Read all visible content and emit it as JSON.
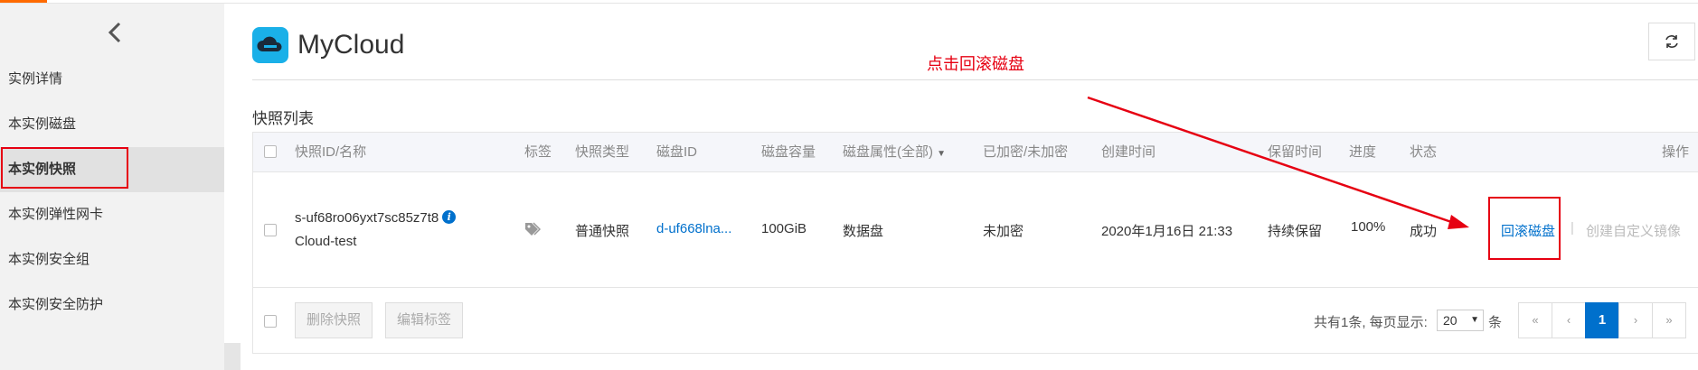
{
  "sidebar": {
    "back_icon": "chevron-left-icon",
    "items": [
      {
        "label": "实例详情"
      },
      {
        "label": "本实例磁盘"
      },
      {
        "label": "本实例快照"
      },
      {
        "label": "本实例弹性网卡"
      },
      {
        "label": "本实例安全组"
      },
      {
        "label": "本实例安全防护"
      }
    ],
    "active_index": 2
  },
  "header": {
    "title": "MyCloud",
    "logo_icon": "cloud-icon",
    "refresh_icon": "refresh-icon",
    "annotation": "点击回滚磁盘"
  },
  "section": {
    "title": "快照列表"
  },
  "table": {
    "columns": [
      "快照ID/名称",
      "标签",
      "快照类型",
      "磁盘ID",
      "磁盘容量",
      "磁盘属性(全部)",
      "已加密/未加密",
      "创建时间",
      "保留时间",
      "进度",
      "状态",
      "操作"
    ],
    "rows": [
      {
        "snapshot_id": "s-uf68ro06yxt7sc85z7t8",
        "snapshot_name": "Cloud-test",
        "tag_icon": "tag-icon",
        "type": "普通快照",
        "disk_id": "d-uf668lna...",
        "capacity": "100GiB",
        "disk_attr": "数据盘",
        "encrypted": "未加密",
        "created": "2020年1月16日 21:33",
        "retention": "持续保留",
        "progress": "100%",
        "status": "成功",
        "action_rollback": "回滚磁盘",
        "action_separator": "|",
        "action_create_image": "创建自定义镜像"
      }
    ]
  },
  "footer": {
    "delete_btn": "删除快照",
    "edit_tag_btn": "编辑标签",
    "total_text": "共有1条, 每页显示:",
    "page_size": "20",
    "unit": "条",
    "pager": {
      "first": "«",
      "prev": "‹",
      "current": "1",
      "next": "›",
      "last": "»"
    }
  },
  "colors": {
    "accent": "#ff6a00",
    "link": "#0070cc",
    "annotation": "#e60012",
    "logo": "#1ab0e8"
  }
}
